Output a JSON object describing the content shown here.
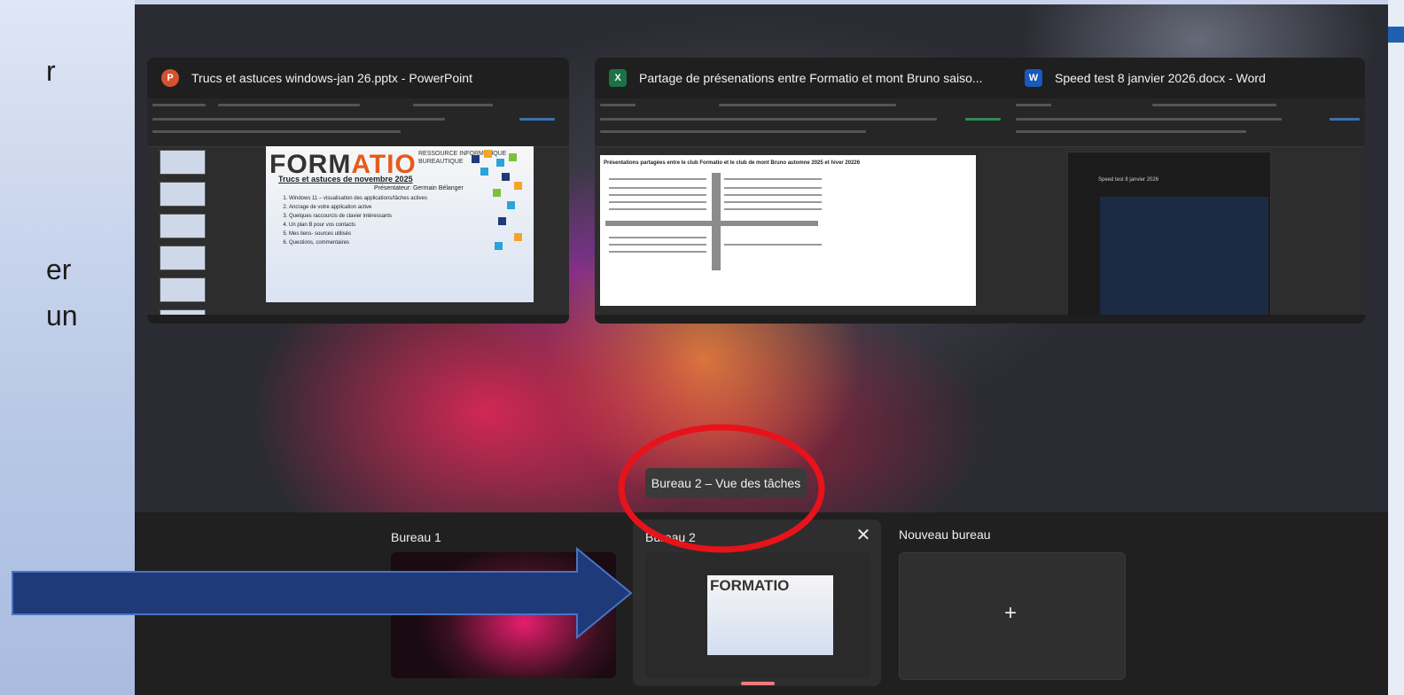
{
  "slide_left": {
    "fragments": [
      "r",
      "er",
      "un"
    ]
  },
  "windows": [
    {
      "app": "PowerPoint",
      "icon": "powerpoint-icon",
      "color": "#d35230",
      "title": "Trucs et astuces windows-jan 26.pptx - PowerPoint"
    },
    {
      "app": "Excel",
      "icon": "excel-icon",
      "color": "#1d7245",
      "title": "Partage de présenations entre Formatio et mont Bruno saiso..."
    },
    {
      "app": "Word",
      "icon": "word-icon",
      "color": "#185abd",
      "title": "Speed test  8 janvier 2026.docx - Word"
    }
  ],
  "ppt_slide": {
    "brand_a": "FORM",
    "brand_b": "ATIO",
    "side": "RESSOURCE INFORMATIQUE BUREAUTIQUE",
    "subtitle": "Trucs et astuces de novembre 2025",
    "presenter": "Présentateur: Germain Bélanger",
    "items": [
      "Windows 11 – visualisation des applications/tâches actives",
      "Ancrage de votre application active",
      "Quelques raccourcis de clavier intéressants",
      "Un plan B pour vos contacts",
      "Mes liens- sources utilisés",
      "Questions, commentaires"
    ]
  },
  "excel_sheet": {
    "heading": "Présentations partagées entre le club Formatio et le club de mont Bruno automne 2025 et hiver 20226"
  },
  "word_doc": {
    "text": "Speed test  8 janvier 2026"
  },
  "tooltip": "Bureau 2 – Vue des tâches",
  "desktops": [
    {
      "label": "Bureau 1"
    },
    {
      "label": "Bureau 2",
      "selected": true
    },
    {
      "label": "Nouveau bureau"
    }
  ],
  "mini_brand": "FORMATIO",
  "annotation": {
    "circle_color": "#e8121b",
    "arrow_color": "#1f3a78",
    "arrow_border": "#4a73c4"
  }
}
